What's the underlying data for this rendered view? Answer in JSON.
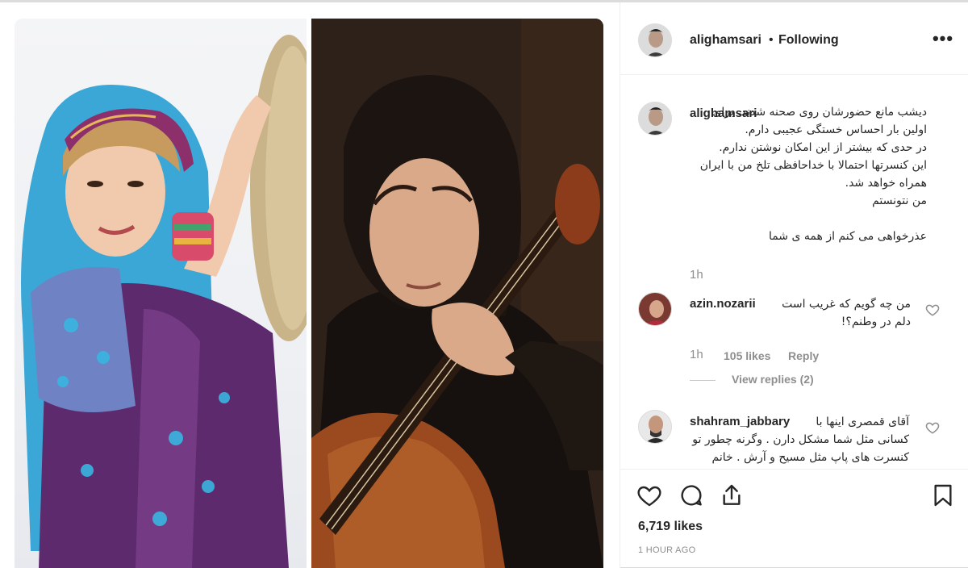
{
  "post": {
    "username": "alighamsari",
    "separator": "•",
    "follow_status": "Following",
    "more_icon": "more-options-icon",
    "timestamp": "1 HOUR AGO",
    "likes": "6,719 likes"
  },
  "comments": [
    {
      "username": "alighamsari",
      "text": "دیشب مانع حضورشان روی صحنه شدند. برای اولین بار احساس خستگی عجیبی دارم.\nدر حدی که بیشتر از این امکان نوشتن ندارم.\nاین کنسرتها احتمالا با خداحافظی تلخ من با ایران همراه خواهد شد.\nمن نتونستم\n\nعذرخواهی می کنم از همه ی شما",
      "time": "1h"
    },
    {
      "username": "azin.nozarii",
      "text": "من چه گویم که غریب است\nدلم در وطنم؟!",
      "time": "1h",
      "likes": "105 likes",
      "reply": "Reply",
      "view_replies": "View replies (2)"
    },
    {
      "username": "shahram_jabbary",
      "text": "آقای قمصری اینها با\nکسانی مثل شما مشکل دارن . وگرنه چطور تو\nکنسرت های پاپ مثل مسیح و آرش . خانم"
    }
  ],
  "icons": {
    "like": "heart-icon",
    "comment": "comment-icon",
    "share": "share-icon",
    "save": "bookmark-icon"
  },
  "colors": {
    "text": "#262626",
    "muted": "#8e8e8e",
    "border": "#efefef"
  }
}
